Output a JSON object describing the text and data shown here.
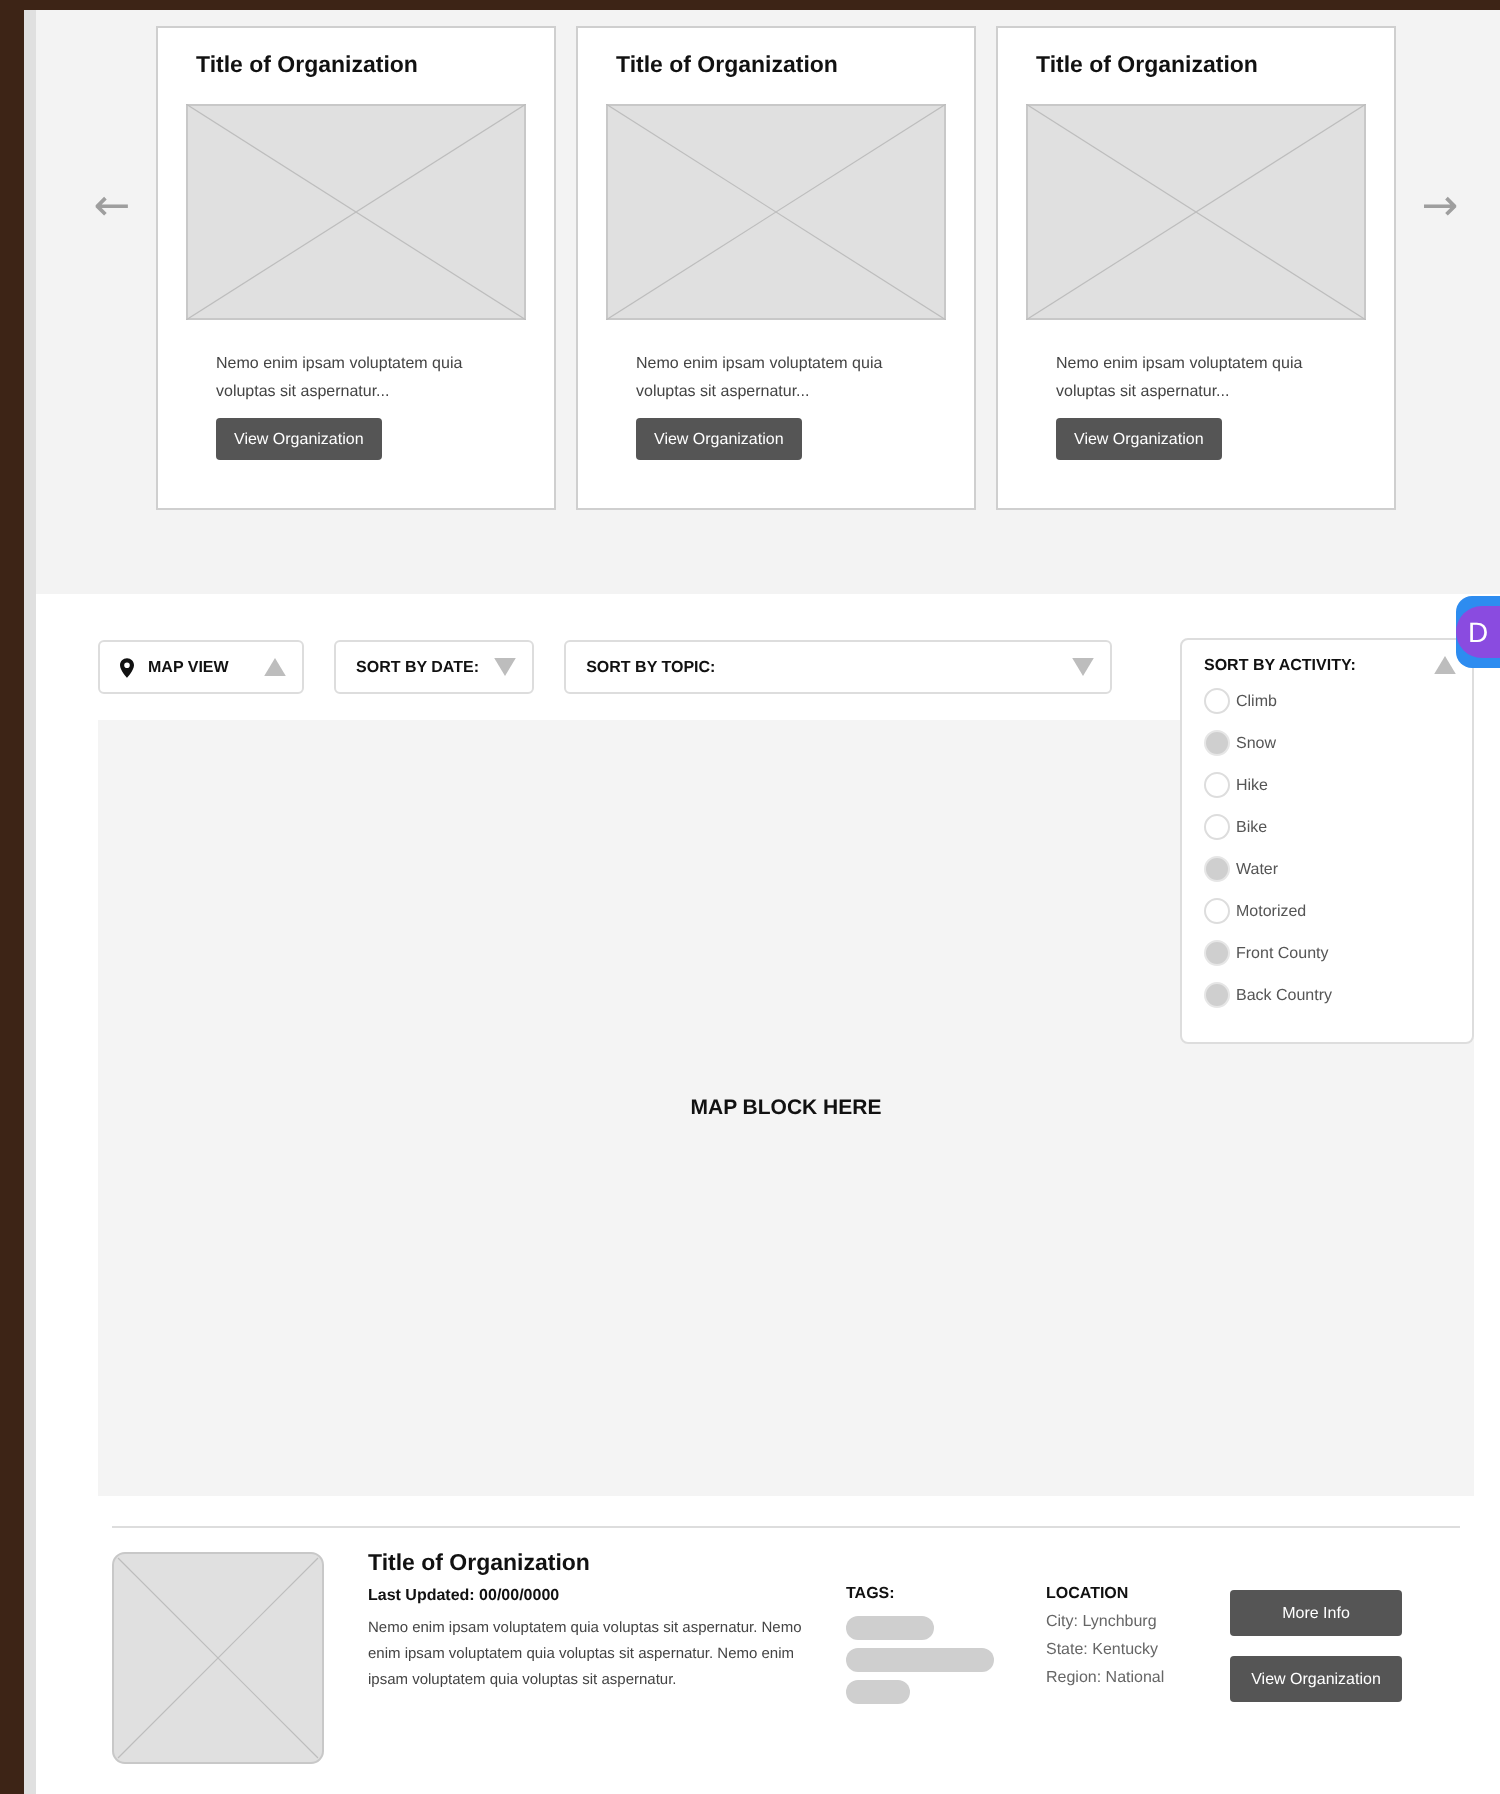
{
  "carousel": {
    "prev": "←",
    "next": "→",
    "cards": [
      {
        "title": "Title of Organization",
        "text": "Nemo enim ipsam voluptatem quia voluptas sit aspernatur...",
        "button": "View Organization"
      },
      {
        "title": "Title of Organization",
        "text": "Nemo enim ipsam voluptatem quia voluptas sit aspernatur...",
        "button": "View Organization"
      },
      {
        "title": "Title of Organization",
        "text": "Nemo enim ipsam voluptatem quia voluptas sit aspernatur...",
        "button": "View Organization"
      }
    ]
  },
  "filters": [
    {
      "label": "MAP VIEW",
      "kind": "map",
      "expanded": true
    },
    {
      "label": "SORT BY DATE:",
      "kind": "sort",
      "expanded": false
    },
    {
      "label": "SORT BY TOPIC:",
      "kind": "sort",
      "expanded": false
    }
  ],
  "activity": {
    "label": "SORT BY ACTIVITY:",
    "expanded": true,
    "options": [
      {
        "label": "Climb",
        "selected": false
      },
      {
        "label": "Snow",
        "selected": true
      },
      {
        "label": "Hike",
        "selected": false
      },
      {
        "label": "Bike",
        "selected": false
      },
      {
        "label": "Water",
        "selected": true
      },
      {
        "label": "Motorized",
        "selected": false
      },
      {
        "label": "Front County",
        "selected": true
      },
      {
        "label": "Back Country",
        "selected": true
      }
    ]
  },
  "map": {
    "label": "MAP BLOCK HERE"
  },
  "badge": "D",
  "listing": {
    "title": "Title of Organization",
    "updated": "Last Updated: 00/00/0000",
    "text": "Nemo enim ipsam voluptatem quia voluptas sit aspernatur. Nemo enim ipsam voluptatem quia voluptas sit aspernatur. Nemo enim ipsam voluptatem quia voluptas sit aspernatur.",
    "tags_label": "TAGS:",
    "tags": [
      {
        "kind": "pill"
      },
      {
        "kind": "pill"
      },
      {
        "kind": "pill"
      }
    ],
    "location_label": "LOCATION",
    "location": [
      "City: Lynchburg",
      "State:  Kentucky",
      "Region: National"
    ],
    "buttons": [
      "More Info",
      "View Organization"
    ]
  }
}
